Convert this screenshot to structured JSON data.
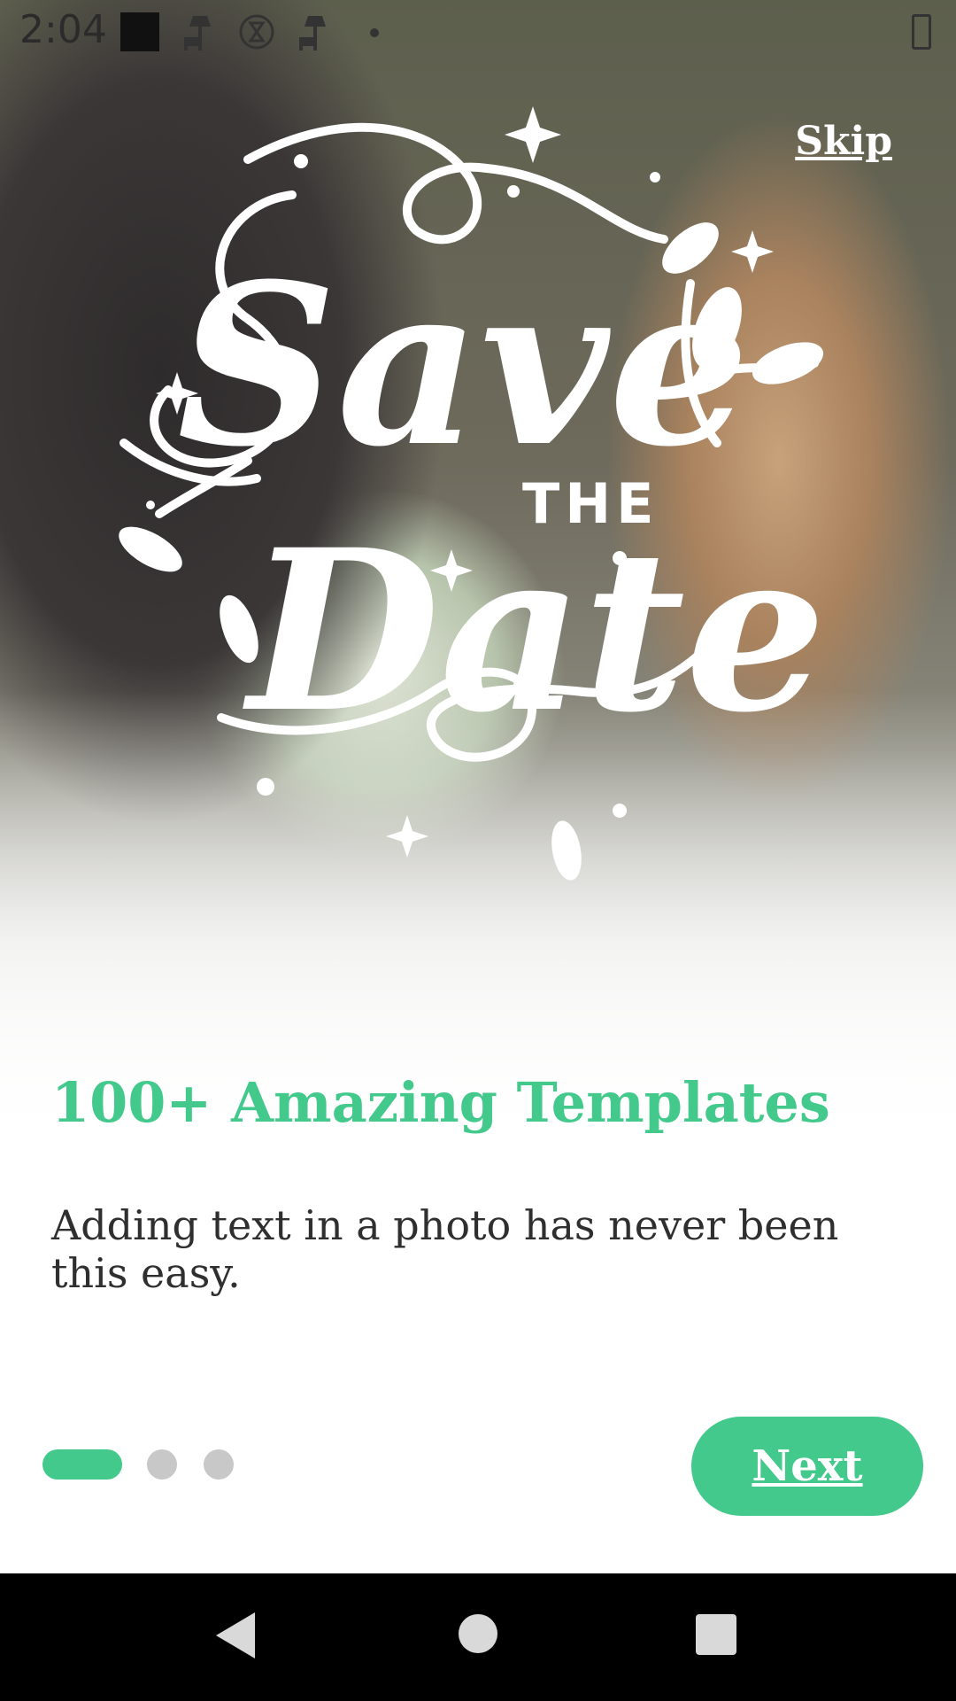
{
  "status_bar": {
    "time": "2:04"
  },
  "onboarding": {
    "skip_label": "Skip",
    "logo_text": "Save THE Date",
    "title": "100+ Amazing Templates",
    "description": "Adding text in a photo has never been this easy.",
    "next_label": "Next",
    "page_index": 1,
    "page_count": 3
  },
  "colors": {
    "accent": "#43c98c",
    "pager_inactive": "#c8c8c8",
    "text_dark": "#2f2f2f",
    "nav_bar": "#000000"
  },
  "icons": [
    "square-icon",
    "lamp-icon",
    "hourglass-icon",
    "battery-icon",
    "back-icon",
    "home-icon",
    "recents-icon"
  ]
}
